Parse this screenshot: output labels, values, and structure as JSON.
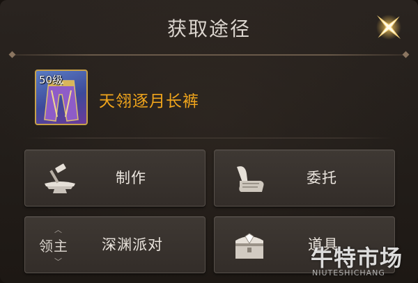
{
  "dialog": {
    "title": "获取途径"
  },
  "item": {
    "level": "50级",
    "name": "天翎逐月长裤",
    "name_color": "#f0a51c"
  },
  "sources": [
    {
      "label": "制作",
      "icon": "anvil-hammer-icon"
    },
    {
      "label": "委托",
      "icon": "quill-scroll-icon"
    },
    {
      "label": "深渊派对",
      "icon": "lord-icon",
      "icon_text": "领主"
    },
    {
      "label": "道具",
      "icon": "treasure-chest-icon"
    }
  ],
  "watermark": {
    "main": "牛特市场",
    "sub": "NIUTESHICHANG"
  },
  "colors": {
    "accent_gold": "#c8a24a",
    "panel_bg": "#231e1a",
    "button_bg": "#3a3430"
  }
}
